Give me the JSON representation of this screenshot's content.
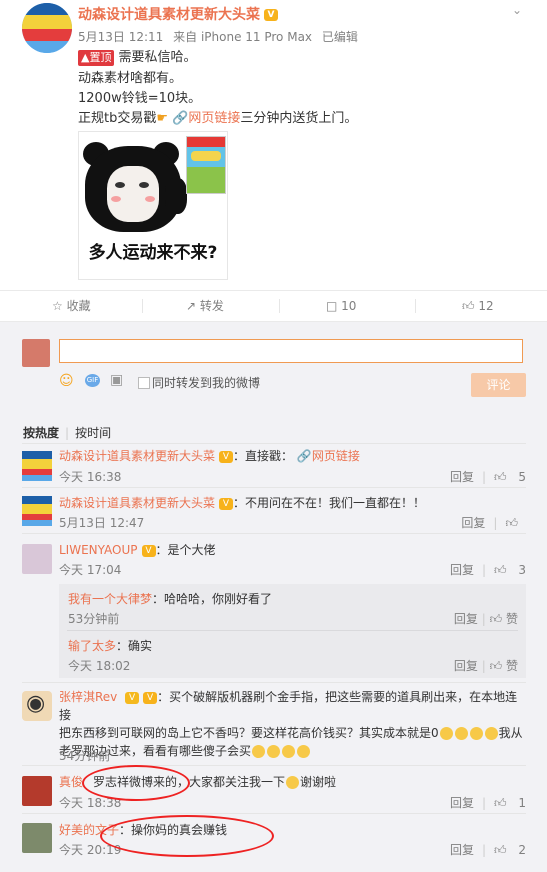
{
  "post": {
    "author": "动森设计道具素材更新大头菜",
    "timestamp": "5月13日 12:11",
    "source": "来自 iPhone 11 Pro Max",
    "edited": "已编辑",
    "pin_label": "置顶",
    "lines": [
      "需要私信哈。",
      "动森素材啥都有。",
      "1200w铃钱=10块。"
    ],
    "line4_prefix": "正规tb交易戳",
    "link_label": "网页链接",
    "line4_suffix": "三分钟内送货上门。",
    "image_caption": "多人运动来不来?"
  },
  "actions": {
    "favorite": "收藏",
    "repost": "转发",
    "comments": "10",
    "likes": "12"
  },
  "composer": {
    "checkbox_label": "同时转发到我的微博",
    "submit": "评论"
  },
  "sort": {
    "hot": "按热度",
    "time": "按时间"
  },
  "comments": [
    {
      "user": "动森设计道具素材更新大头菜",
      "text": "：直接戳：",
      "link": "网页链接",
      "time": "今天 16:38",
      "reply": "回复",
      "likes": "5"
    },
    {
      "user": "动森设计道具素材更新大头菜",
      "text": "：不用问在不在！我们一直都在！！",
      "time": "5月13日 12:47",
      "reply": "回复",
      "likes": ""
    },
    {
      "user": "LIWENYAOUP",
      "text": "：是个大佬",
      "time": "今天 17:04",
      "reply": "回复",
      "likes": "3",
      "replies": [
        {
          "user": "我有一个大律梦",
          "text": "：哈哈哈，你刚好看了",
          "time": "53分钟前",
          "reply": "回复",
          "like": "赞"
        },
        {
          "user": "输了太多",
          "text": "：确实",
          "time": "今天 18:02",
          "reply": "回复",
          "like": "赞"
        }
      ]
    },
    {
      "user": "张梓淇Rev",
      "text_1": "：买个破解版机器刷个金手指，把这些需要的道具刷出来，在本地连接",
      "text_2": "把东西移到可联网的岛上它不香吗？要这样花高价钱买？其实成本就是0",
      "text_2b": "我从",
      "text_3": "老罗那边过来，看看有哪些傻子会买",
      "time": "54分钟前",
      "reply": "回复",
      "likes": ""
    },
    {
      "user": "真俊",
      "text": "罗志祥微博来的，大家都关注我一下",
      "text_end": "谢谢啦",
      "time": "今天 18:38",
      "reply": "回复",
      "likes": "1"
    },
    {
      "user": "好美的文子",
      "text": "：操你妈的真会赚钱",
      "time": "今天 20:19",
      "reply": "回复",
      "likes": "2"
    }
  ],
  "colors": {
    "accent": "#eb7350",
    "annotation": "#e22222",
    "panel": "#f2f2f5"
  }
}
